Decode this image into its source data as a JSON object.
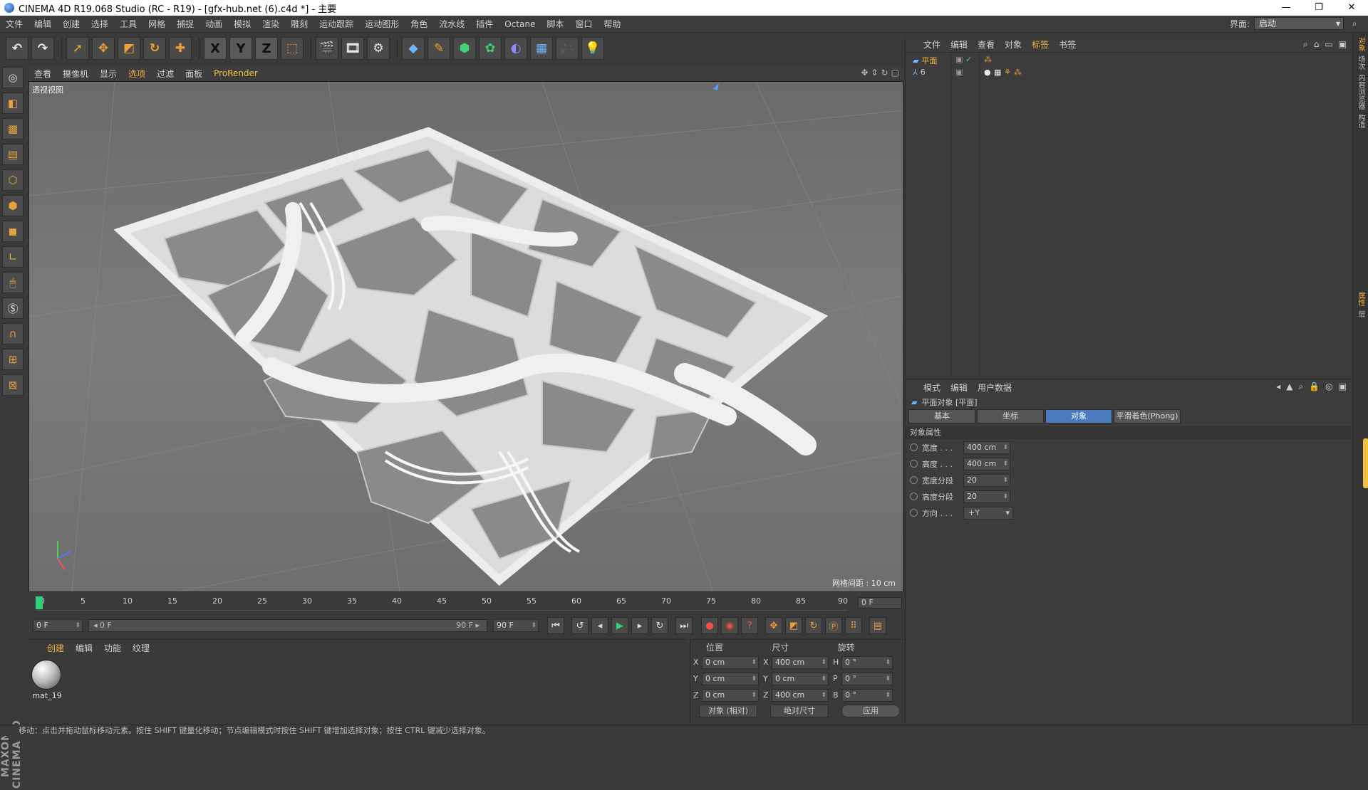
{
  "window": {
    "title": "CINEMA 4D R19.068 Studio (RC - R19) - [gfx-hub.net (6).c4d *] - 主要",
    "controls": [
      "—",
      "❐",
      "✕"
    ]
  },
  "menubar": {
    "items": [
      "文件",
      "编辑",
      "创建",
      "选择",
      "工具",
      "网格",
      "捕捉",
      "动画",
      "模拟",
      "渲染",
      "雕刻",
      "运动跟踪",
      "运动图形",
      "角色",
      "流水线",
      "插件",
      "Octane",
      "脚本",
      "窗口",
      "帮助"
    ],
    "layout_label": "界面:",
    "layout_value": "启动"
  },
  "toolbar": {
    "axis_x": "X",
    "axis_y": "Y",
    "axis_z": "Z"
  },
  "viewport": {
    "menu": [
      "查看",
      "摄像机",
      "显示",
      "选项",
      "过滤",
      "面板",
      "ProRender"
    ],
    "label": "透视视图",
    "grid_info": "网格间距 : 10 cm"
  },
  "timeline": {
    "ticks": [
      "0",
      "5",
      "10",
      "15",
      "20",
      "25",
      "30",
      "35",
      "40",
      "45",
      "50",
      "55",
      "60",
      "65",
      "70",
      "75",
      "80",
      "85",
      "90"
    ],
    "current_frame": "0 F",
    "start_field": "0 F",
    "range_left": "◂ 0 F",
    "range_right": "90 F ▸",
    "end_field": "90 F"
  },
  "material_manager": {
    "menu": [
      "创建",
      "编辑",
      "功能",
      "纹理"
    ],
    "material_name": "mat_19"
  },
  "coord_manager": {
    "headers": [
      "位置",
      "尺寸",
      "旋转"
    ],
    "rows": [
      {
        "pos_axis": "X",
        "pos": "0 cm",
        "size_axis": "X",
        "size": "400 cm",
        "rot_axis": "H",
        "rot": "0 °"
      },
      {
        "pos_axis": "Y",
        "pos": "0 cm",
        "size_axis": "Y",
        "size": "0 cm",
        "rot_axis": "P",
        "rot": "0 °"
      },
      {
        "pos_axis": "Z",
        "pos": "0 cm",
        "size_axis": "Z",
        "size": "400 cm",
        "rot_axis": "B",
        "rot": "0 °"
      }
    ],
    "mode": "对象 (相对)",
    "size_mode": "绝对尺寸",
    "apply": "应用"
  },
  "object_manager": {
    "menu": [
      "文件",
      "编辑",
      "查看",
      "对象",
      "标签",
      "书签"
    ],
    "objects": [
      {
        "name": "平面"
      },
      {
        "name": "6"
      }
    ]
  },
  "attribute_manager": {
    "menu": [
      "模式",
      "编辑",
      "用户数据"
    ],
    "object_title": "平面对象 [平面]",
    "tabs": [
      "基本",
      "坐标",
      "对象",
      "平滑着色(Phong)"
    ],
    "section": "对象属性",
    "props": [
      {
        "label": "宽度 . . .",
        "value": "400 cm"
      },
      {
        "label": "高度 . . .",
        "value": "400 cm"
      },
      {
        "label": "宽度分段",
        "value": "20"
      },
      {
        "label": "高度分段",
        "value": "20"
      }
    ],
    "orientation_label": "方向 . . .",
    "orientation_value": "+Y"
  },
  "right_tabs": [
    "对象",
    "场次",
    "内容浏览器",
    "构造",
    "属性",
    "层"
  ],
  "maxon_logo": "MAXON CINEMA 4D",
  "statusbar": "移动：点击并拖动鼠标移动元素。按住 SHIFT 键量化移动；节点编辑模式时按住 SHIFT 键增加选择对象；按住 CTRL 键减少选择对象。"
}
